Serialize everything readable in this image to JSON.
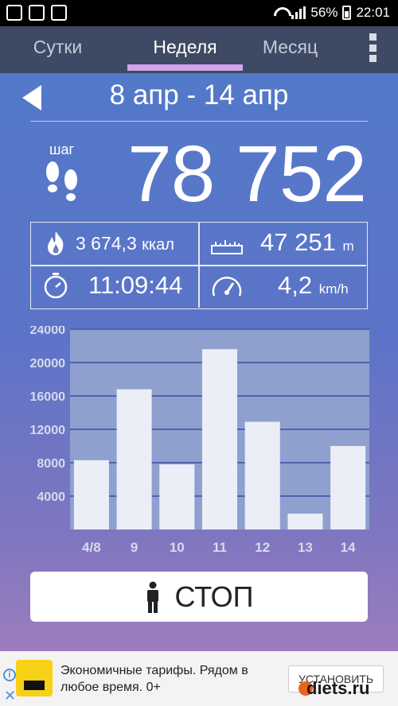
{
  "status_bar": {
    "battery_percent": "56%",
    "time": "22:01"
  },
  "tabs": [
    {
      "label": "Сутки",
      "active": false
    },
    {
      "label": "Неделя",
      "active": true
    },
    {
      "label": "Месяц",
      "active": false
    }
  ],
  "range": {
    "label": "8 апр - 14 апр"
  },
  "steps": {
    "label": "шаг",
    "value": "78 752"
  },
  "stats": {
    "calories": {
      "value": "3 674,3",
      "unit": "ккал"
    },
    "distance": {
      "value": "47 251",
      "unit": "m"
    },
    "duration": {
      "value": "11:09:44"
    },
    "speed": {
      "value": "4,2",
      "unit": "km/h"
    }
  },
  "chart_data": {
    "type": "bar",
    "categories": [
      "4/8",
      "9",
      "10",
      "11",
      "12",
      "13",
      "14"
    ],
    "values": [
      8300,
      16800,
      7800,
      21600,
      12900,
      1900,
      10000
    ],
    "yticks": [
      4000,
      8000,
      12000,
      16000,
      20000,
      24000
    ],
    "ylim": [
      0,
      24000
    ],
    "grid": true,
    "colors": {
      "bar": "#eceef7",
      "plot_bg": "#8fa0cf",
      "grid": "#4f63b0",
      "tick": "#d6dbec"
    }
  },
  "actions": {
    "stop_label": "СТОП"
  },
  "ad": {
    "text": "Экономичные тарифы. Рядом в любое время. 0+",
    "install_label": "УСТАНОВИТЬ",
    "watermark": "diets.ru"
  }
}
